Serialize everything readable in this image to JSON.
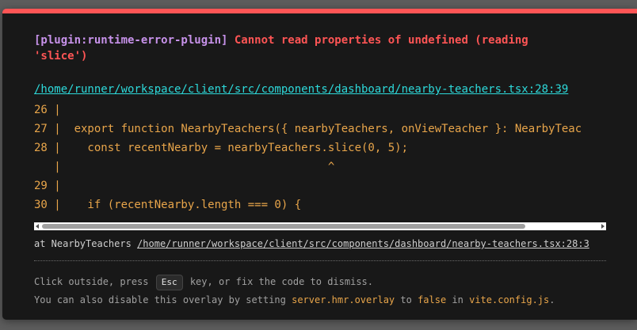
{
  "error": {
    "plugin": "[plugin:runtime-error-plugin]",
    "message": "Cannot read properties of undefined (reading\n'slice')",
    "file": "/home/runner/workspace/client/src/components/dashboard/nearby-teachers.tsx:28:39"
  },
  "frame": {
    "lines": [
      "26 |",
      "27 |  export function NearbyTeachers({ nearbyTeachers, onViewTeacher }: NearbyTeac",
      "28 |    const recentNearby = nearbyTeachers.slice(0, 5);",
      "   |                                        ^",
      "29 |",
      "30 |    if (recentNearby.length === 0) {"
    ]
  },
  "stack": {
    "prefix": "at NearbyTeachers ",
    "link": "/home/runner/workspace/client/src/components/dashboard/nearby-teachers.tsx:28:3"
  },
  "tip": {
    "line1_before": "Click outside, press ",
    "key": "Esc",
    "line1_after": " key, or fix the code to dismiss.",
    "line2_before": "You can also disable this overlay by setting ",
    "setting": "server.hmr.overlay",
    "line2_mid": " to ",
    "value": "false",
    "line2_mid2": " in ",
    "config_file": "vite.config.js",
    "line2_after": "."
  },
  "colors": {
    "accent_red": "#ff5555",
    "plugin_purple": "#c792ea",
    "link_cyan": "#2dd9da",
    "code_yellow": "#e8a54a"
  }
}
